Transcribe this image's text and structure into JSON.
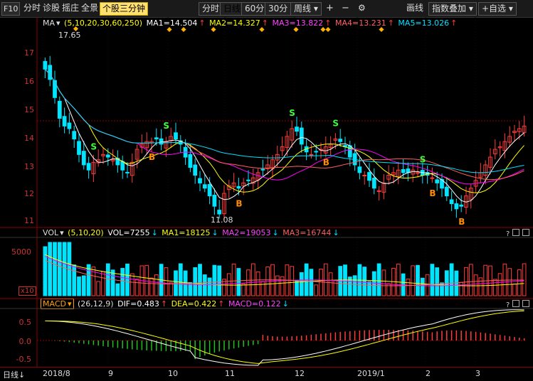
{
  "toolbar": {
    "f10": "F10",
    "items": [
      "分时",
      "诊股",
      "摇庄",
      "全景"
    ],
    "active": "个股三分钟",
    "periods": [
      "分时",
      "日线",
      "60分",
      "30分"
    ],
    "period_selected": "日线",
    "week": "周线",
    "draw": "画线",
    "index_overlay": "指数叠加",
    "add_self": "+自选"
  },
  "price_header": {
    "name": "MA",
    "params": "(5,10,20,30,60,250)",
    "ma1": "MA1=14.504",
    "ma2": "MA2=14.327",
    "ma3": "MA3=13.822",
    "ma4": "MA4=13.231",
    "ma5": "MA5=13.026"
  },
  "price_axis": [
    "17",
    "16",
    "15",
    "14",
    "13",
    "12",
    "11"
  ],
  "price_marks": {
    "high": "17.65",
    "low": "11.08"
  },
  "vol_header": {
    "name": "VOL",
    "params": "(5,10,20)",
    "vol": "VOL=7255",
    "ma1": "MA1=18125",
    "ma2": "MA2=19053",
    "ma3": "MA3=16744"
  },
  "vol_axis": {
    "top": "5000",
    "unit": "x10"
  },
  "macd_header": {
    "name": "MACD",
    "params": "(26,12,9)",
    "dif": "DIF=0.483",
    "dea": "DEA=0.422",
    "macd": "MACD=0.122"
  },
  "macd_axis": [
    "0.5",
    "0.0",
    "-0.5"
  ],
  "x_labels": [
    "2018/8",
    "9",
    "10",
    "11",
    "12",
    "2019/1",
    "2",
    "3"
  ],
  "footer_period": "日线",
  "signals": {
    "sell": "S",
    "buy": "B"
  },
  "colors": {
    "up": "#ff3b3b",
    "down": "#00e5ff",
    "ma1": "#ffffff",
    "ma2": "#ffff00",
    "ma3": "#ff00ff",
    "ma4": "#ff6060",
    "ma5": "#00e0ff",
    "grid": "#8b0000"
  },
  "chart_data": {
    "type": "candlestick",
    "close": [
      16.9,
      16.5,
      15.8,
      15.0,
      14.7,
      14.6,
      14.2,
      13.6,
      13.2,
      13.0,
      13.3,
      13.4,
      13.6,
      13.5,
      13.4,
      13.2,
      13.0,
      12.9,
      13.3,
      13.8,
      14.0,
      14.1,
      14.1,
      14.2,
      14.0,
      14.1,
      14.3,
      14.2,
      14.0,
      13.5,
      13.1,
      12.8,
      12.5,
      12.3,
      12.0,
      11.6,
      11.3,
      12.1,
      12.4,
      12.5,
      12.3,
      12.5,
      12.6,
      12.7,
      12.9,
      13.0,
      13.2,
      13.4,
      13.6,
      13.9,
      14.3,
      14.6,
      14.5,
      14.0,
      13.7,
      13.6,
      13.7,
      13.8,
      13.9,
      14.0,
      14.2,
      14.1,
      13.9,
      13.5,
      13.2,
      12.9,
      12.8,
      12.6,
      12.3,
      12.2,
      12.5,
      12.8,
      12.9,
      13.0,
      12.9,
      12.9,
      13.0,
      12.9,
      12.8,
      12.8,
      12.7,
      12.5,
      12.3,
      12.0,
      11.7,
      11.5,
      11.6,
      12.0,
      12.3,
      12.6,
      12.9,
      13.2,
      13.5,
      13.8,
      13.9,
      14.1,
      14.3,
      14.5,
      14.6,
      14.7
    ]
  }
}
